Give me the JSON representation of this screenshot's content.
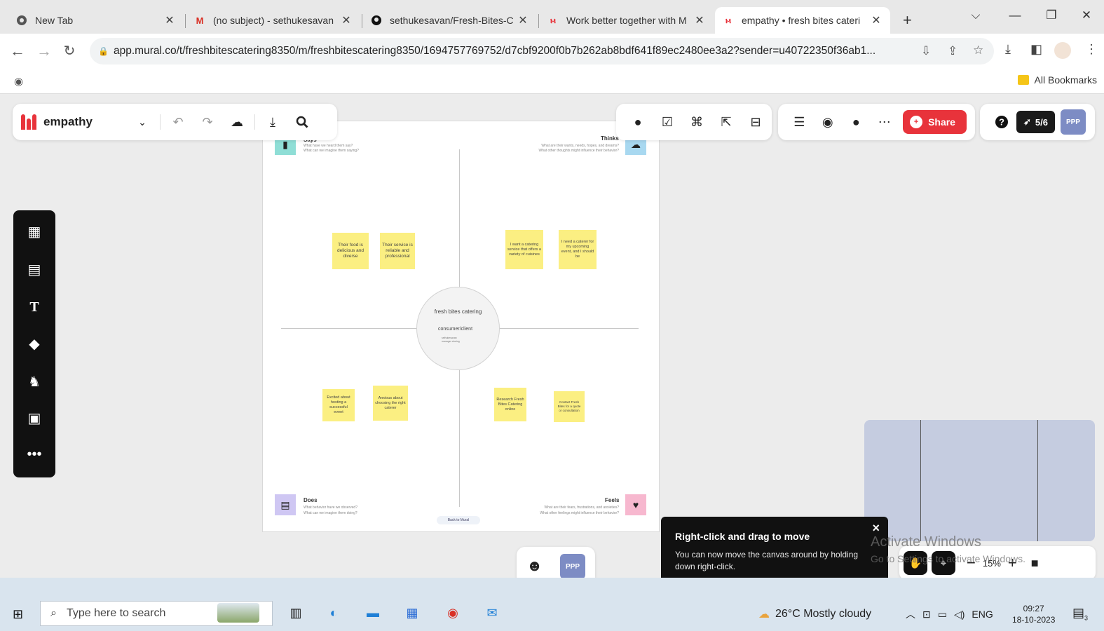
{
  "browser": {
    "tabs": [
      {
        "title": "New Tab",
        "icon": "chrome-icon"
      },
      {
        "title": "(no subject) - sethukesavan",
        "icon": "gmail-icon"
      },
      {
        "title": "sethukesavan/Fresh-Bites-C",
        "icon": "github-icon"
      },
      {
        "title": "Work better together with M",
        "icon": "mural-icon"
      },
      {
        "title": "empathy • fresh bites cateri",
        "icon": "mural-icon",
        "active": true
      }
    ],
    "new_tab_label": "+",
    "url": "app.mural.co/t/freshbitescatering8350/m/freshbitescatering8350/1694757769752/d7cbf9200f0b7b262ab8bdf641f89ec2480ee3a2?sender=u40722350f36ab1...",
    "bookmarks_label": "All Bookmarks"
  },
  "mural": {
    "title": "empathy",
    "share_label": "Share",
    "timer_label": "5/6",
    "avatar_label": "PPP",
    "brand_color": "#e8333b",
    "board": {
      "quadrants": {
        "says": {
          "title": "Says",
          "sub1": "What have we heard them say?",
          "sub2": "What can we imagine them saying?"
        },
        "thinks": {
          "title": "Thinks",
          "sub1": "What are their wants, needs, hopes, and dreams?",
          "sub2": "What other thoughts might influence their behavior?"
        },
        "does": {
          "title": "Does",
          "sub1": "What behavior have we observed?",
          "sub2": "What can we imagine them doing?"
        },
        "feels": {
          "title": "Feels",
          "sub1": "What are their fears, frustrations, and anxieties?",
          "sub2": "What other feelings might influence their behavior?"
        }
      },
      "center": {
        "title": "fresh bites catering",
        "persona": "consumer/client",
        "detail": "sethukesavan manager closing"
      },
      "stickies": [
        {
          "text": "Their food is delicious and diverse"
        },
        {
          "text": "Their service is reliable and professional"
        },
        {
          "text": "I want a catering service that offers a variety of cuisines"
        },
        {
          "text": "I need a caterer for my upcoming event, and I should be"
        },
        {
          "text": "Excited about hosting a successful event"
        },
        {
          "text": "Anxious about choosing the right caterer"
        },
        {
          "text": "Research Fresh Bites Catering online"
        },
        {
          "text": "Contact Fresh Bites for a quote or consultation"
        }
      ],
      "link_label": "Back to Mural"
    },
    "toast": {
      "title": "Right-click and drag to move",
      "body": "You can now move the canvas around by holding down right-click.",
      "close": "×"
    },
    "zoom_label": "15%",
    "bottom_avatar": "PPP"
  },
  "watermark": {
    "line1": "Activate Windows",
    "line2": "Go to Settings to activate Windows."
  },
  "taskbar": {
    "search_placeholder": "Type here to search",
    "weather": "26°C  Mostly cloudy",
    "language": "ENG",
    "time": "09:27",
    "date": "18-10-2023",
    "notification_count": "3"
  }
}
